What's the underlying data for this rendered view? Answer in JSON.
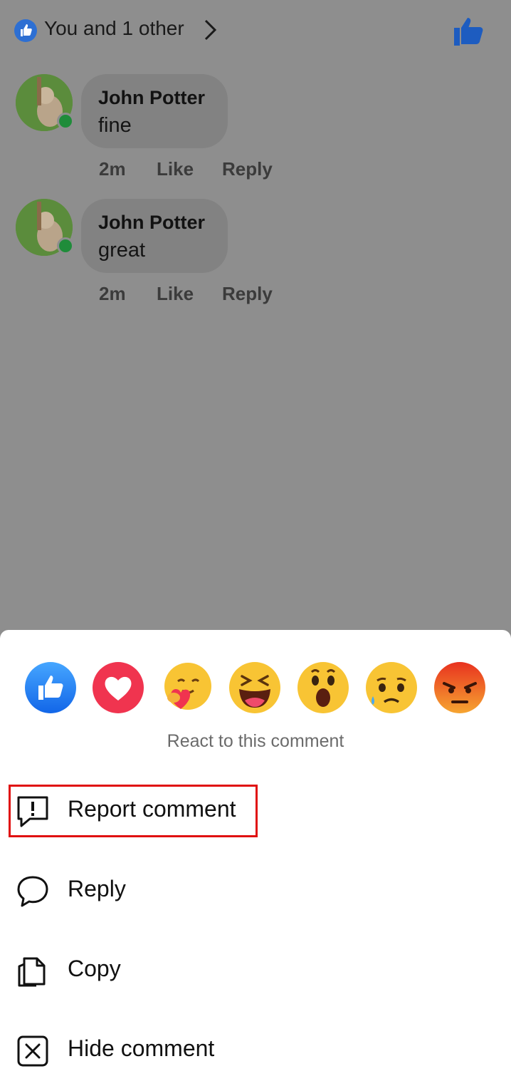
{
  "top": {
    "reactors_text": "You and 1 other",
    "icons": [
      "thumbs-up-badge-icon",
      "chevron-right-icon",
      "thumbs-up-icon"
    ]
  },
  "comments": [
    {
      "author": "John Potter",
      "text": "fine",
      "time": "2m",
      "like_label": "Like",
      "reply_label": "Reply"
    },
    {
      "author": "John Potter",
      "text": "great",
      "time": "2m",
      "like_label": "Like",
      "reply_label": "Reply"
    }
  ],
  "sheet": {
    "reactions": [
      "like",
      "love",
      "care",
      "haha",
      "wow",
      "sad",
      "angry"
    ],
    "caption": "React to this comment",
    "menu": [
      {
        "label": "Report comment",
        "icon": "report-icon",
        "highlighted": true
      },
      {
        "label": "Reply",
        "icon": "speech-bubble-icon"
      },
      {
        "label": "Copy",
        "icon": "copy-icon"
      },
      {
        "label": "Hide comment",
        "icon": "close-box-icon"
      }
    ]
  },
  "colors": {
    "overlay": "#8e8e8e",
    "facebook_blue": "#2d6fd3",
    "highlight_red": "#e01010",
    "online_green": "#1f8c3a"
  }
}
